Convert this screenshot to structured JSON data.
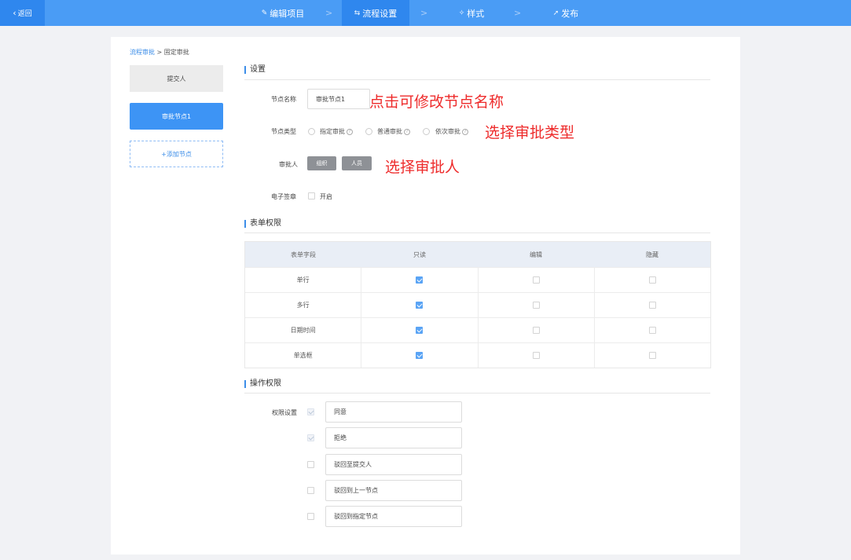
{
  "topbar": {
    "back_label": "返回",
    "steps": [
      {
        "label": "编辑项目",
        "icon": "edit-icon"
      },
      {
        "label": "流程设置",
        "icon": "flow-icon"
      },
      {
        "label": "样式",
        "icon": "style-icon"
      },
      {
        "label": "发布",
        "icon": "send-icon"
      }
    ],
    "separator": ">",
    "active_step": "流程设置",
    "accent_color": "#4a9cf5"
  },
  "breadcrumb": {
    "parent": "流程审批",
    "sep": ">",
    "current": "固定审批"
  },
  "nodes": {
    "submitter": "提交人",
    "approval": "审批节点1",
    "add": "+添加节点"
  },
  "settings": {
    "title": "设置",
    "node_name_label": "节点名称",
    "node_name_value": "审批节点1",
    "node_type_label": "节点类型",
    "node_types": [
      "指定审批",
      "普通审批",
      "依次审批"
    ],
    "approver_label": "审批人",
    "approver_buttons": [
      "组织",
      "人员"
    ],
    "esign_label": "电子签章",
    "esign_option": "开启"
  },
  "annotations": {
    "node_name_hint": "点击可修改节点名称",
    "node_type_hint": "选择审批类型",
    "approver_hint": "选择审批人"
  },
  "form_permissions": {
    "title": "表单权限",
    "columns": [
      "表单字段",
      "只读",
      "编辑",
      "隐藏"
    ],
    "rows": [
      {
        "field": "单行",
        "readonly": true,
        "edit": false,
        "hidden": false
      },
      {
        "field": "多行",
        "readonly": true,
        "edit": false,
        "hidden": false
      },
      {
        "field": "日期时间",
        "readonly": true,
        "edit": false,
        "hidden": false
      },
      {
        "field": "单选框",
        "readonly": true,
        "edit": false,
        "hidden": false
      }
    ]
  },
  "operation_permissions": {
    "title": "操作权限",
    "label": "权限设置",
    "options": [
      {
        "label": "同意",
        "checked": true
      },
      {
        "label": "拒绝",
        "checked": true
      },
      {
        "label": "驳回至提交人",
        "checked": false
      },
      {
        "label": "驳回到上一节点",
        "checked": false
      },
      {
        "label": "驳回到指定节点",
        "checked": false
      }
    ]
  }
}
